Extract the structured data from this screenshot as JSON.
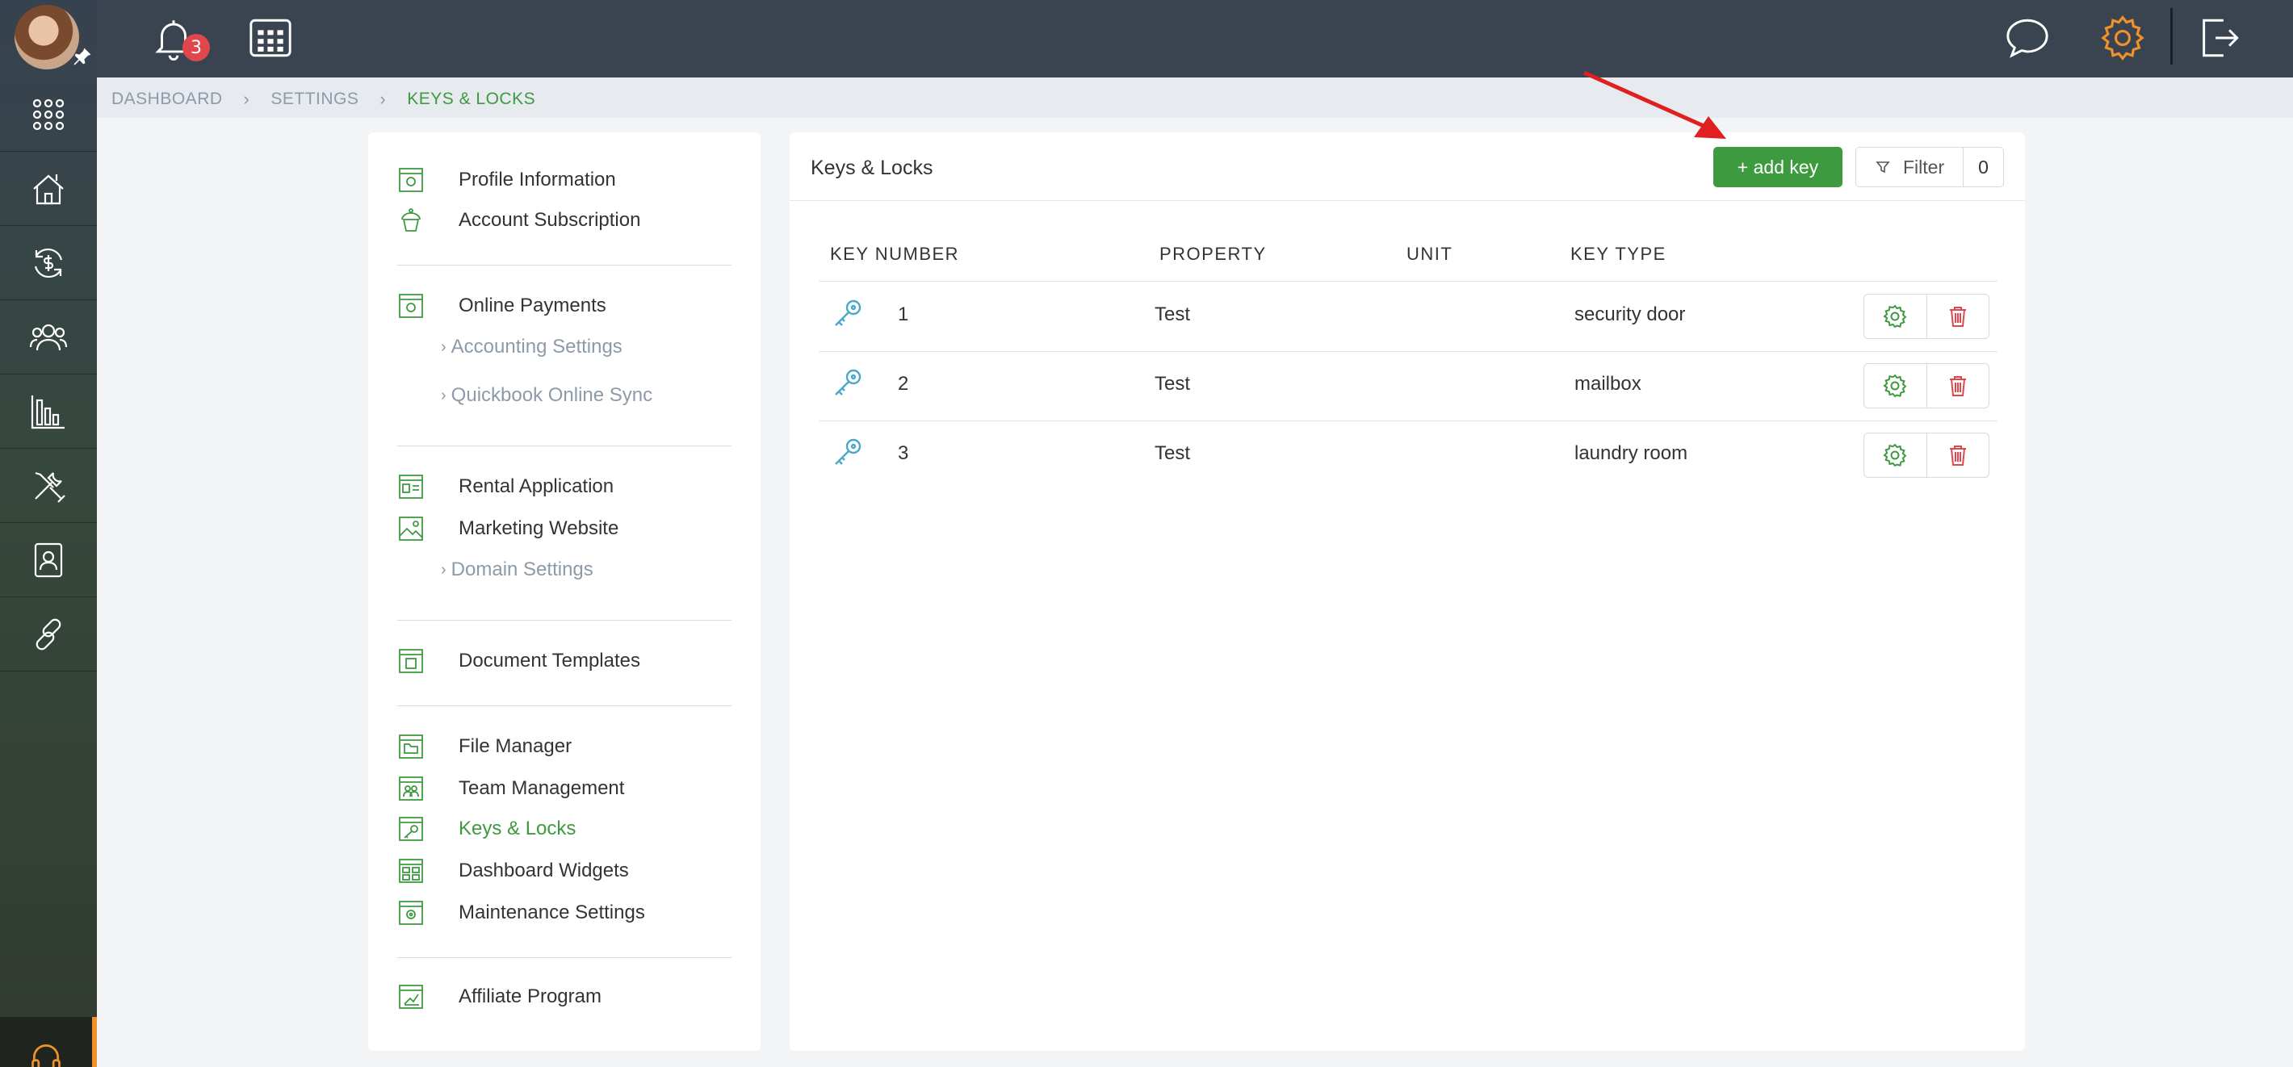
{
  "topbar": {
    "notification_count": "3"
  },
  "breadcrumb": [
    "DASHBOARD",
    "SETTINGS",
    "KEYS & LOCKS"
  ],
  "menu": {
    "profile_information": "Profile Information",
    "account_subscription": "Account Subscription",
    "online_payments": "Online Payments",
    "accounting_settings": "Accounting Settings",
    "quickbook_online_sync": "Quickbook Online Sync",
    "rental_application": "Rental Application",
    "marketing_website": "Marketing Website",
    "domain_settings": "Domain Settings",
    "document_templates": "Document Templates",
    "file_manager": "File Manager",
    "team_management": "Team Management",
    "keys_locks": "Keys & Locks",
    "dashboard_widgets": "Dashboard Widgets",
    "maintenance_settings": "Maintenance Settings",
    "affiliate_program": "Affiliate Program"
  },
  "panel": {
    "title": "Keys & Locks",
    "add_label": "+ add key",
    "filter_label": "Filter",
    "filter_count": "0",
    "columns": [
      "KEY NUMBER",
      "PROPERTY",
      "UNIT",
      "KEY TYPE"
    ],
    "rows": [
      {
        "key_number": "1",
        "property": "Test",
        "unit": "",
        "key_type": "security door"
      },
      {
        "key_number": "2",
        "property": "Test",
        "unit": "",
        "key_type": "mailbox"
      },
      {
        "key_number": "3",
        "property": "Test",
        "unit": "",
        "key_type": "laundry room"
      }
    ]
  },
  "colors": {
    "accent_green": "#3d9a3f",
    "danger_red": "#e0474c",
    "orange": "#f0922b",
    "topbar": "#3a4350",
    "key_blue": "#4aa9c9"
  }
}
